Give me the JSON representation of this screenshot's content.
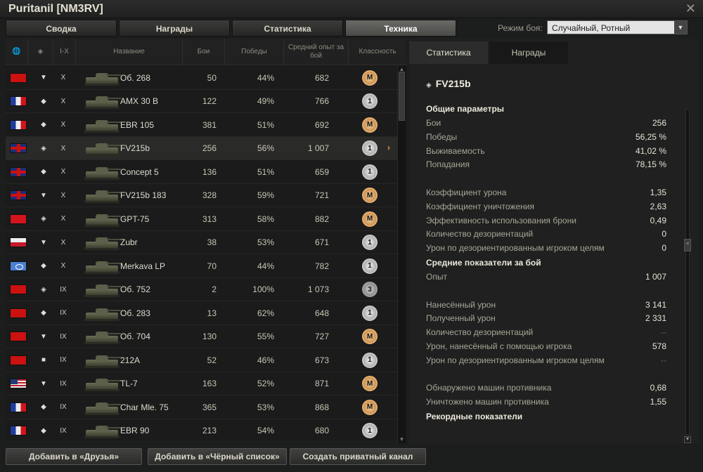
{
  "window": {
    "title": "Puritanil [NM3RV]"
  },
  "top_tabs": [
    {
      "label": "Сводка"
    },
    {
      "label": "Награды"
    },
    {
      "label": "Статистика"
    },
    {
      "label": "Техника",
      "active": true
    }
  ],
  "battle_mode": {
    "label": "Режим боя:",
    "value": "Случайный, Ротный"
  },
  "table": {
    "headers": {
      "nation": "nation-globe-icon",
      "type": "vehicle-type-icon",
      "tier": "I-X",
      "name": "Название",
      "battles": "Бои",
      "wins": "Победы",
      "exp": "Средний опыт за бой",
      "mastery": "Классность"
    },
    "rows": [
      {
        "nation": "ussr",
        "type": "▼",
        "tier": "X",
        "name": "Об. 268",
        "battles": "50",
        "wins": "44%",
        "exp": "682",
        "mastery": "M"
      },
      {
        "nation": "france",
        "type": "◆",
        "tier": "X",
        "name": "AMX 30 B",
        "battles": "122",
        "wins": "49%",
        "exp": "766",
        "mastery": "1"
      },
      {
        "nation": "france",
        "type": "◆",
        "tier": "X",
        "name": "EBR 105",
        "battles": "381",
        "wins": "51%",
        "exp": "692",
        "mastery": "M"
      },
      {
        "nation": "uk",
        "type": "◈",
        "tier": "X",
        "name": "FV215b",
        "battles": "256",
        "wins": "56%",
        "exp": "1 007",
        "mastery": "1",
        "selected": true
      },
      {
        "nation": "uk",
        "type": "◆",
        "tier": "X",
        "name": "Concept 5",
        "battles": "136",
        "wins": "51%",
        "exp": "659",
        "mastery": "1"
      },
      {
        "nation": "uk",
        "type": "▼",
        "tier": "X",
        "name": "FV215b 183",
        "battles": "328",
        "wins": "59%",
        "exp": "721",
        "mastery": "M"
      },
      {
        "nation": "china",
        "type": "◈",
        "tier": "X",
        "name": "GPT-75",
        "battles": "313",
        "wins": "58%",
        "exp": "882",
        "mastery": "M"
      },
      {
        "nation": "poland",
        "type": "▼",
        "tier": "X",
        "name": "Zubr",
        "battles": "38",
        "wins": "53%",
        "exp": "671",
        "mastery": "1"
      },
      {
        "nation": "intunion",
        "type": "◆",
        "tier": "X",
        "name": "Merkava LP",
        "battles": "70",
        "wins": "44%",
        "exp": "782",
        "mastery": "1"
      },
      {
        "nation": "ussr",
        "type": "◈",
        "tier": "IX",
        "name": "Об. 752",
        "battles": "2",
        "wins": "100%",
        "exp": "1 073",
        "mastery": "3"
      },
      {
        "nation": "ussr",
        "type": "◆",
        "tier": "IX",
        "name": "Об. 283",
        "battles": "13",
        "wins": "62%",
        "exp": "648",
        "mastery": "1"
      },
      {
        "nation": "ussr",
        "type": "▼",
        "tier": "IX",
        "name": "Об. 704",
        "battles": "130",
        "wins": "55%",
        "exp": "727",
        "mastery": "M"
      },
      {
        "nation": "ussr",
        "type": "■",
        "tier": "IX",
        "name": "212А",
        "battles": "52",
        "wins": "46%",
        "exp": "673",
        "mastery": "1"
      },
      {
        "nation": "usa",
        "type": "▼",
        "tier": "IX",
        "name": "TL-7",
        "battles": "163",
        "wins": "52%",
        "exp": "871",
        "mastery": "M"
      },
      {
        "nation": "france",
        "type": "◆",
        "tier": "IX",
        "name": "Char Mle. 75",
        "battles": "365",
        "wins": "53%",
        "exp": "868",
        "mastery": "M"
      },
      {
        "nation": "france",
        "type": "◆",
        "tier": "IX",
        "name": "EBR 90",
        "battles": "213",
        "wins": "54%",
        "exp": "680",
        "mastery": "1"
      }
    ]
  },
  "right_tabs": [
    {
      "label": "Статистика",
      "active": true
    },
    {
      "label": "Награды"
    }
  ],
  "details": {
    "vehicle": "FV215b",
    "sections": [
      {
        "kind": "header",
        "label": "Общие параметры"
      },
      {
        "kind": "row",
        "label": "Бои",
        "value": "256"
      },
      {
        "kind": "row",
        "label": "Победы",
        "value": "56,25 %"
      },
      {
        "kind": "row",
        "label": "Выживаемость",
        "value": "41,02 %"
      },
      {
        "kind": "row",
        "label": "Попадания",
        "value": "78,15 %"
      },
      {
        "kind": "gap"
      },
      {
        "kind": "row",
        "label": "Коэффициент урона",
        "value": "1,35"
      },
      {
        "kind": "row",
        "label": "Коэффициент уничтожения",
        "value": "2,63"
      },
      {
        "kind": "row",
        "label": "Эффективность использования брони",
        "value": "0,49"
      },
      {
        "kind": "row",
        "label": "Количество дезориентаций",
        "value": "0"
      },
      {
        "kind": "row",
        "label": "Урон по дезориентированным игроком целям",
        "value": "0"
      },
      {
        "kind": "header",
        "label": "Средние показатели за бой"
      },
      {
        "kind": "row",
        "label": "Опыт",
        "value": "1 007"
      },
      {
        "kind": "gap"
      },
      {
        "kind": "row",
        "label": "Нанесённый урон",
        "value": "3 141"
      },
      {
        "kind": "row",
        "label": "Полученный урон",
        "value": "2 331"
      },
      {
        "kind": "row",
        "label": "Количество дезориентаций",
        "value": "--",
        "dim": true
      },
      {
        "kind": "row",
        "label": "Урон, нанесённый с помощью игрока",
        "value": "578"
      },
      {
        "kind": "row",
        "label": "Урон по дезориентированным игроком целям",
        "value": "--",
        "dim": true
      },
      {
        "kind": "gap"
      },
      {
        "kind": "row",
        "label": "Обнаружено машин противника",
        "value": "0,68"
      },
      {
        "kind": "row",
        "label": "Уничтожено машин противника",
        "value": "1,55"
      },
      {
        "kind": "header",
        "label": "Рекордные показатели"
      }
    ]
  },
  "bottom_buttons": [
    {
      "label": "Добавить в «Друзья»"
    },
    {
      "label": "Добавить в «Чёрный список»"
    },
    {
      "label": "Создать приватный канал"
    }
  ],
  "colors": {
    "accent": "#e89a2b",
    "mastery_gold": "#d79a55",
    "selected_row": "#2a2b29"
  }
}
